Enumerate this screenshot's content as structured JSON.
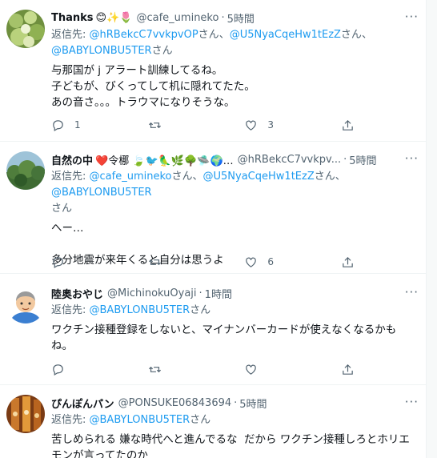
{
  "tweets": [
    {
      "name": "Thanks",
      "emojis": "😊✨🌷",
      "handle": "@cafe_umineko",
      "time": "5時間",
      "reply_prefix": "返信先: ",
      "mentions": [
        "@hRBekcC7vvkpvOP",
        "@U5NyaCqeHw1tEzZ",
        "@BABYLONBU5TER"
      ],
      "san": "さん",
      "sep": "、",
      "text": "与那国が j アラート訓練してるね。\n子どもが、びくってして机に隠れてたた。\nあの音さ。。。トラウマになりそうな。",
      "counts": {
        "reply": "1",
        "retweet": "",
        "like": "3"
      }
    },
    {
      "name": "自然の中",
      "emojis": "❤️令梛 🍃🐦🦜🌿🌳🛸🌍…",
      "handle": "@hRBekcC7vvkpv...",
      "time": "5時間",
      "reply_prefix": "返信先: ",
      "mentions": [
        "@cafe_umineko",
        "@U5NyaCqeHw1tEzZ",
        "@BABYLONBU5TER"
      ],
      "san": "さん",
      "sep": "、",
      "text": "へー…\n\n多分地震が来年くると自分は思うよ",
      "counts": {
        "reply": "",
        "retweet": "",
        "like": "6"
      }
    },
    {
      "name": "陸奥おやじ",
      "emojis": "",
      "handle": "@MichinokuOyaji",
      "time": "1時間",
      "reply_prefix": "返信先: ",
      "mentions": [
        "@BABYLONBU5TER"
      ],
      "san": "さん",
      "sep": "、",
      "text": "ワクチン接種登録をしないと、マイナンバーカードが使えなくなるかも\nね。",
      "counts": {
        "reply": "",
        "retweet": "",
        "like": ""
      }
    },
    {
      "name": "ぴんぽんパン",
      "emojis": "",
      "handle": "@PONSUKE06843694",
      "time": "5時間",
      "reply_prefix": "返信先: ",
      "mentions": [
        "@BABYLONBU5TER"
      ],
      "san": "さん",
      "sep": "、",
      "text": "苦しめられる 嫌な時代へと進んでるな  だから ワクチン接種しろとホリエ\nモンが言ってたのか",
      "counts": {
        "reply": "",
        "retweet": "",
        "like": ""
      }
    }
  ],
  "colors": {
    "link": "#1d9bf0",
    "muted": "#536471",
    "text": "#0f1419"
  },
  "icons": {
    "reply": "reply-icon",
    "retweet": "retweet-icon",
    "like": "like-icon",
    "share": "share-icon",
    "more": "more-icon"
  }
}
